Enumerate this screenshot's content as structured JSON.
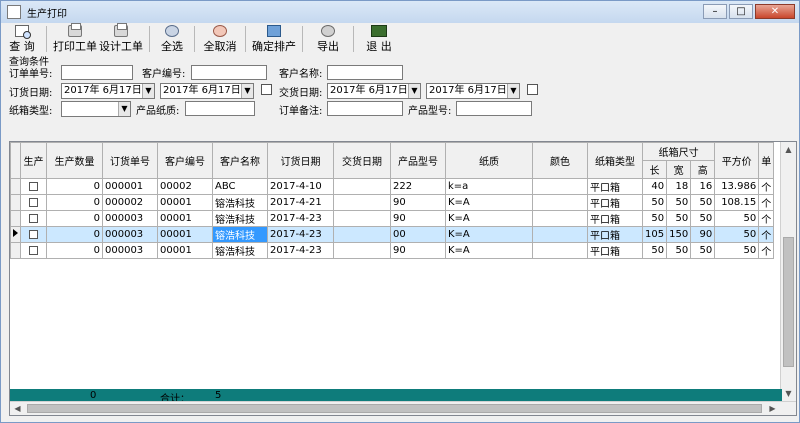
{
  "window": {
    "title": "生产打印"
  },
  "toolbar": {
    "query": "查 询",
    "print_order": "打印工单",
    "design_order": "设计工单",
    "select_all": "全选",
    "unselect_all": "全取消",
    "confirm_schedule": "确定排产",
    "export": "导出",
    "exit": "退 出"
  },
  "criteria": {
    "group_label": "查询条件",
    "order_no_label": "订单单号:",
    "customer_no_label": "客户编号:",
    "customer_name_label": "客户名称:",
    "order_date_label": "订货日期:",
    "order_date_from": "2017年 6月17日",
    "order_date_to": "2017年 6月17日",
    "delivery_date_label": "交货日期:",
    "delivery_date_from": "2017年 6月17日",
    "delivery_date_to": "2017年 6月17日",
    "box_type_label": "纸箱类型:",
    "paper_label": "产品纸质:",
    "order_note_label": "订单备注:",
    "product_model_label": "产品型号:"
  },
  "table": {
    "headers": {
      "produce": "生产",
      "qty": "生产数量",
      "order_no": "订货单号",
      "cust_no": "客户编号",
      "cust_name": "客户名称",
      "order_date": "订货日期",
      "delivery_date": "交货日期",
      "model": "产品型号",
      "paper": "纸质",
      "color": "颜色",
      "box_type": "纸箱类型",
      "box_size": "纸箱尺寸",
      "length": "长",
      "width": "宽",
      "height": "高",
      "unit_price": "平方价",
      "unit": "单"
    },
    "rows": [
      {
        "qty": "0",
        "order_no": "000001",
        "cust_no": "00002",
        "cust_name": "ABC",
        "order_date": "2017-4-10",
        "delivery_date": "",
        "model": "222",
        "paper": "k=a",
        "color": "",
        "box_type": "平口箱",
        "l": "40",
        "w": "18",
        "h": "16",
        "price": "13.986",
        "unit": "个"
      },
      {
        "qty": "0",
        "order_no": "000002",
        "cust_no": "00001",
        "cust_name": "镕浩科技",
        "order_date": "2017-4-21",
        "delivery_date": "",
        "model": "90",
        "paper": "K=A",
        "color": "",
        "box_type": "平口箱",
        "l": "50",
        "w": "50",
        "h": "50",
        "price": "108.15",
        "unit": "个"
      },
      {
        "qty": "0",
        "order_no": "000003",
        "cust_no": "00001",
        "cust_name": "镕浩科技",
        "order_date": "2017-4-23",
        "delivery_date": "",
        "model": "90",
        "paper": "K=A",
        "color": "",
        "box_type": "平口箱",
        "l": "50",
        "w": "50",
        "h": "50",
        "price": "50",
        "unit": "个"
      },
      {
        "qty": "0",
        "order_no": "000003",
        "cust_no": "00001",
        "cust_name": "镕浩科技",
        "order_date": "2017-4-23",
        "delivery_date": "",
        "model": "00",
        "paper": "K=A",
        "color": "",
        "box_type": "平口箱",
        "l": "105",
        "w": "150",
        "h": "90",
        "price": "50",
        "unit": "个"
      },
      {
        "qty": "0",
        "order_no": "000003",
        "cust_no": "00001",
        "cust_name": "镕浩科技",
        "order_date": "2017-4-23",
        "delivery_date": "",
        "model": "90",
        "paper": "K=A",
        "color": "",
        "box_type": "平口箱",
        "l": "50",
        "w": "50",
        "h": "50",
        "price": "50",
        "unit": "个"
      }
    ]
  },
  "totals": {
    "qty": "0",
    "label": "合计：",
    "count": "5"
  },
  "colors": {
    "totals_bar": "#0e7c7b",
    "selected_row": "#cce8ff",
    "selected_cell": "#3399ff"
  }
}
